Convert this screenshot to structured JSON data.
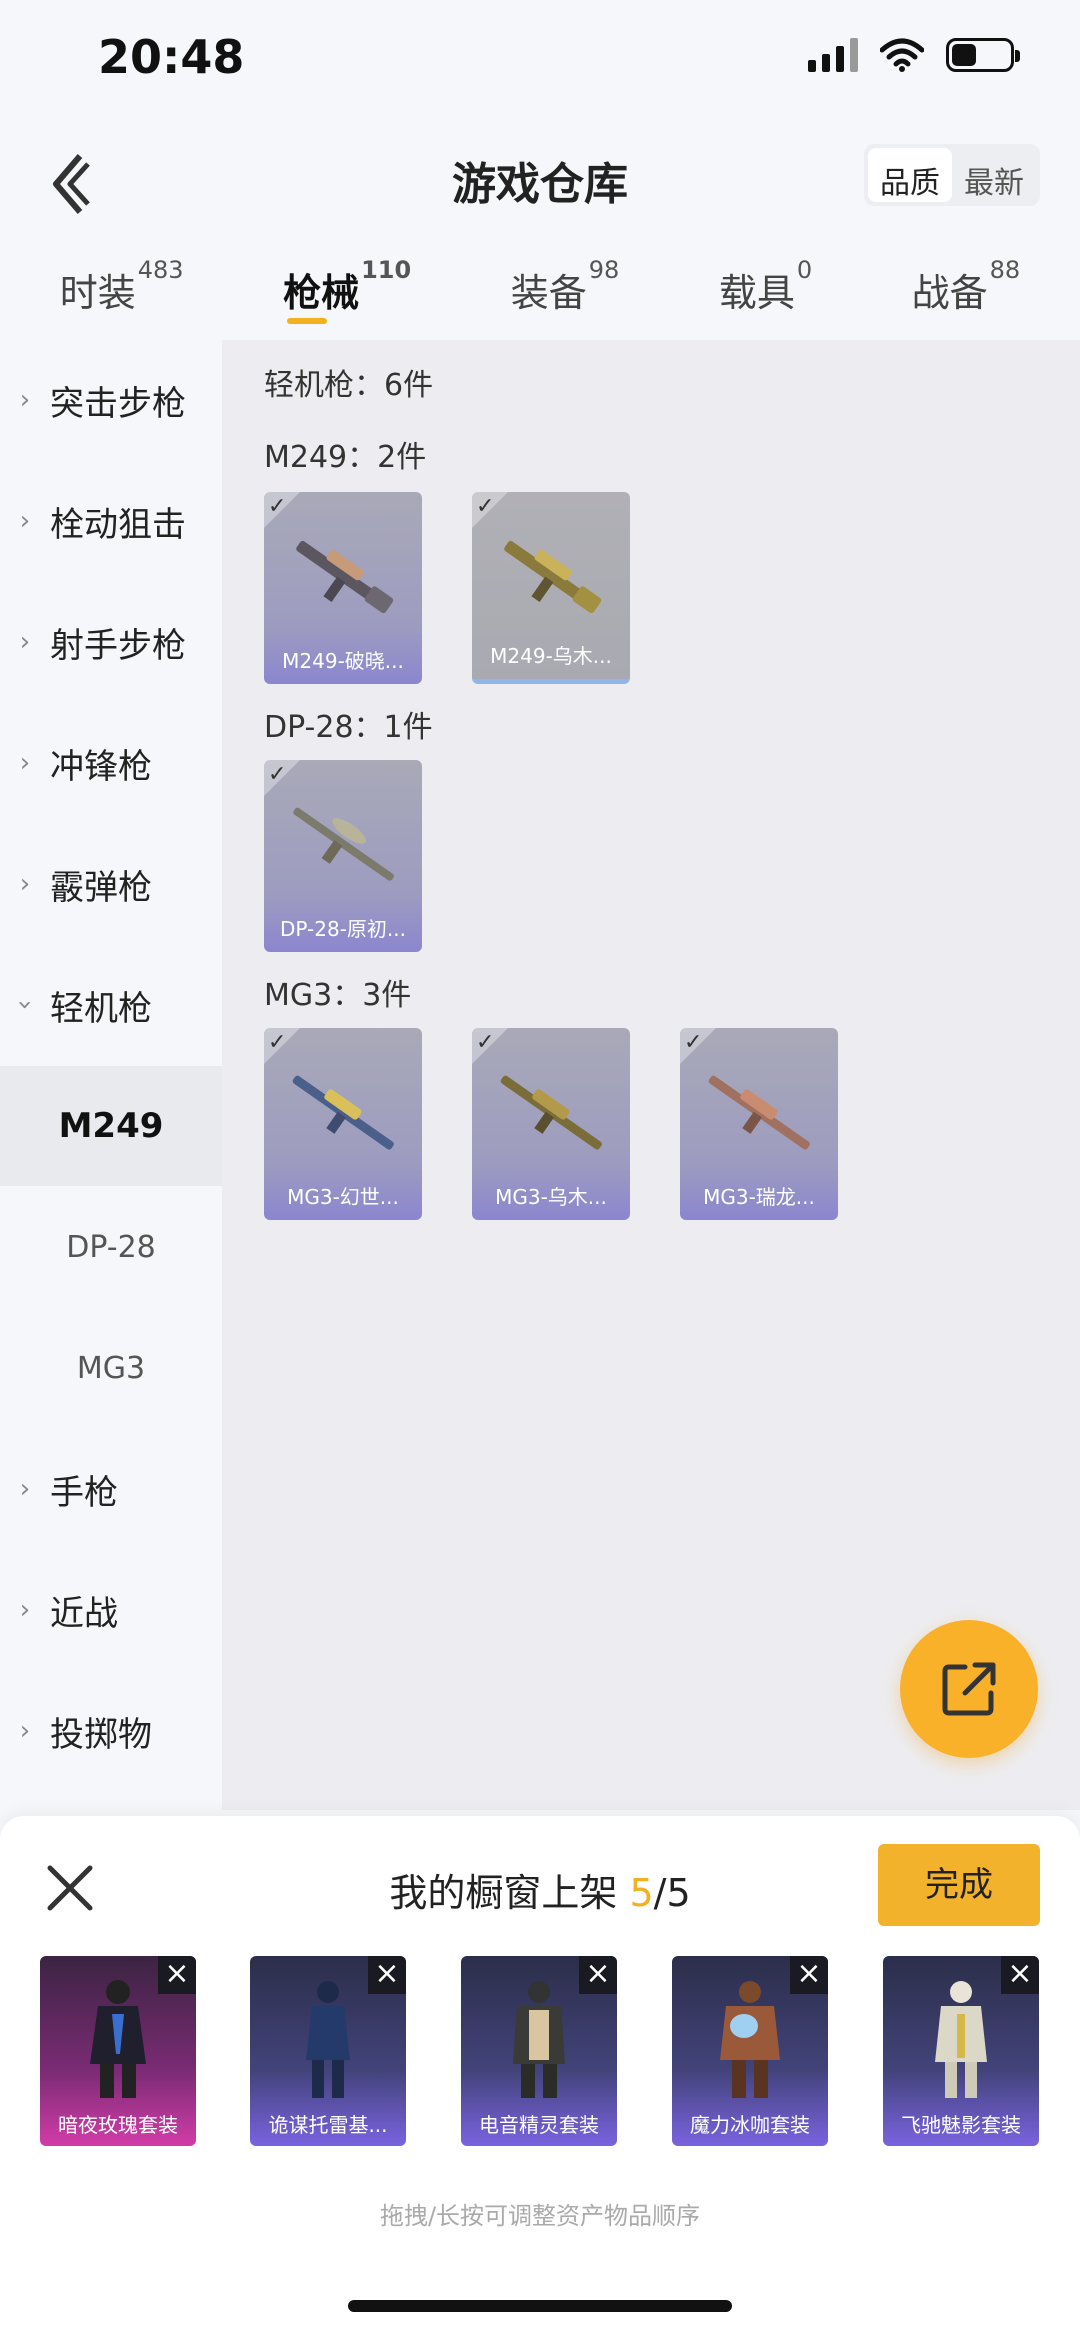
{
  "status": {
    "time": "20:48"
  },
  "header": {
    "title": "游戏仓库",
    "sort_quality": "品质",
    "sort_newest": "最新"
  },
  "tabs": [
    {
      "label": "时装",
      "count": "483"
    },
    {
      "label": "枪械",
      "count": "110"
    },
    {
      "label": "装备",
      "count": "98"
    },
    {
      "label": "载具",
      "count": "0"
    },
    {
      "label": "战备",
      "count": "88"
    }
  ],
  "sidebar": {
    "items": [
      "突击步枪",
      "栓动狙击",
      "射手步枪",
      "冲锋枪",
      "霰弹枪",
      "轻机枪",
      "手枪",
      "近战",
      "投掷物"
    ],
    "subs": [
      "M249",
      "DP-28",
      "MG3"
    ]
  },
  "content": {
    "section_title": "轻机枪：6件",
    "groups": [
      {
        "title": "M249：2件",
        "items": [
          "M249-破晓...",
          "M249-乌木..."
        ]
      },
      {
        "title": "DP-28：1件",
        "items": [
          "DP-28-原初..."
        ]
      },
      {
        "title": "MG3：3件",
        "items": [
          "MG3-幻世...",
          "MG3-乌木...",
          "MG3-瑞龙..."
        ]
      }
    ]
  },
  "sheet": {
    "title_prefix": "我的橱窗上架",
    "count_current": "5",
    "count_total": "/5",
    "done_label": "完成",
    "items": [
      "暗夜玫瑰套装",
      "诡谋托雷基...",
      "电音精灵套装",
      "魔力冰咖套装",
      "飞驰魅影套装"
    ],
    "hint": "拖拽/长按可调整资产物品顺序"
  },
  "colors": {
    "accent": "#f3b01f",
    "fab": "#f9b12a"
  }
}
